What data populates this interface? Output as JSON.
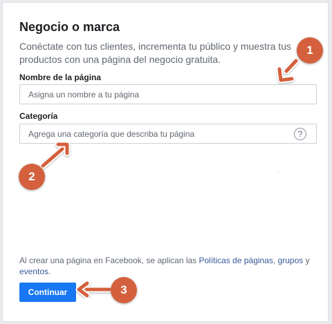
{
  "header": {
    "title": "Negocio o marca"
  },
  "description": "Conéctate con tus clientes, incrementa tu público y muestra tus productos con una página del negocio gratuita.",
  "form": {
    "page_name": {
      "label": "Nombre de la página",
      "placeholder": "Asigna un nombre a tu página"
    },
    "category": {
      "label": "Categoría",
      "placeholder": "Agrega una categoría que describa tu página",
      "help_icon_glyph": "?"
    }
  },
  "legal": {
    "prefix": "Al crear una página en Facebook, se aplican las ",
    "link_policies": "Políticas de páginas",
    "sep1": ", ",
    "link_groups": "grupos",
    "sep2": " y ",
    "link_events": "eventos",
    "suffix": "."
  },
  "continue_label": "Continuar",
  "annotations": {
    "badge_1": "1",
    "badge_2": "2",
    "badge_3": "3",
    "color": "#d4603d"
  },
  "colors": {
    "primary": "#1877f2",
    "link": "#385898",
    "annotation": "#d4603d"
  }
}
